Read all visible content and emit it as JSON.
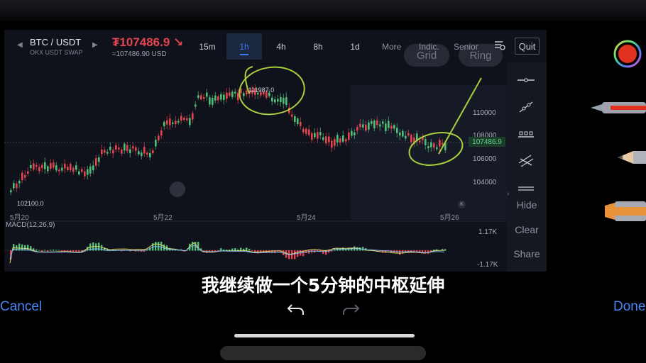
{
  "header": {
    "pair": "BTC / USDT",
    "sub": "OKX USDT SWAP",
    "price": "₮107486.9 ↘",
    "price_usd": "≈107486.90 USD"
  },
  "timeframes": [
    {
      "label": "15m"
    },
    {
      "label": "1h"
    },
    {
      "label": "4h"
    },
    {
      "label": "8h"
    },
    {
      "label": "1d"
    }
  ],
  "menu": {
    "more": "More",
    "indic": "Indic.",
    "senior": "Senior",
    "quit": "Quit"
  },
  "overlay": {
    "grid": "Grid",
    "ring": "Ring"
  },
  "chart": {
    "price_labels": [
      "110000",
      "108000",
      "106000",
      "104000"
    ],
    "last_price": "107486.9",
    "high_label": "111987.0",
    "low_label": "102100.0",
    "dates": [
      "5月20",
      "5月22",
      "5月24",
      "5月26"
    ],
    "macd_label": "MACD(12,26,9)",
    "macd_top": "1.17K",
    "macd_bottom": "-1.17K",
    "k_icon": "K"
  },
  "side": {
    "hide": "Hide",
    "clear": "Clear",
    "share": "Share"
  },
  "bottom": {
    "subtitle": "我继续做一个5分钟的中枢延伸",
    "cancel": "Cancel",
    "done": "Done"
  },
  "colors": {
    "accent": "#3d7cf0",
    "down": "#e2454f",
    "up": "#4fbf7a",
    "annotation": "#a8cf3e",
    "ios_blue": "#4b86f4"
  }
}
